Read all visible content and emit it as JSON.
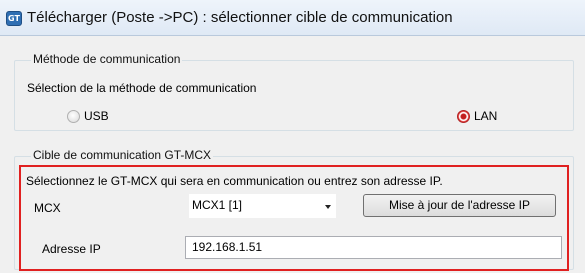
{
  "window": {
    "title": "Télécharger (Poste ->PC) : sélectionner cible de communication",
    "app_icon": "GT",
    "app_icon_name": "gt-app-icon"
  },
  "method_group": {
    "legend": "Méthode de communication",
    "selection_label": "Sélection de la méthode de communication",
    "options": [
      {
        "label": "USB",
        "selected": false
      },
      {
        "label": "LAN",
        "selected": true
      }
    ]
  },
  "target_group": {
    "legend": "Cible de communication GT-MCX",
    "instruction": "Sélectionnez le GT-MCX  qui sera en communication ou entrez  son adresse IP.",
    "mcx_label": "MCX",
    "mcx_value": "MCX1 [1]",
    "update_button": "Mise à jour de l'adresse IP",
    "ip_label": "Adresse IP",
    "ip_value": "192.168.1.51"
  },
  "colors": {
    "highlight": "#e02020",
    "radio_selected": "#c31f1f",
    "title_bar": "#dfe9f5",
    "dialog_bg": "#f0f0f0"
  }
}
